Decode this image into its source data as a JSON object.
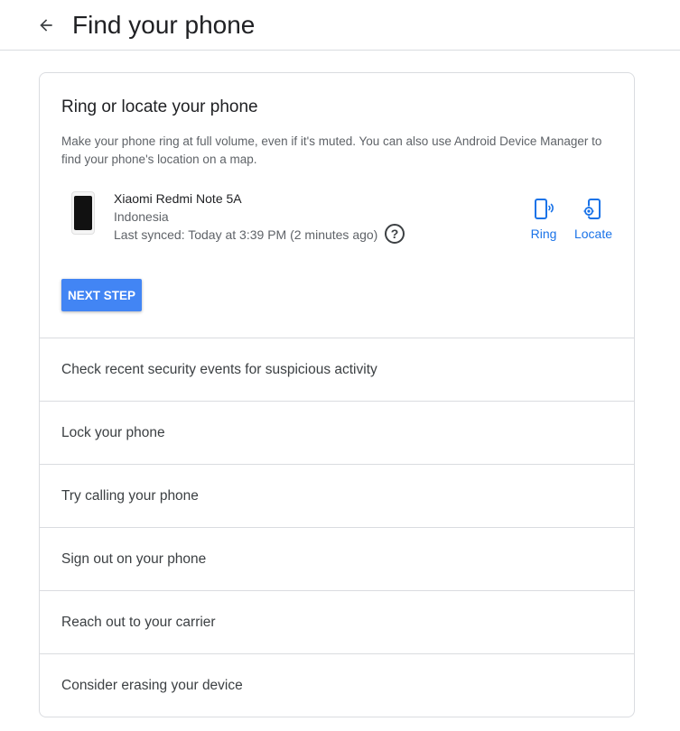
{
  "header": {
    "title": "Find your phone"
  },
  "ring_locate": {
    "title": "Ring or locate your phone",
    "description": "Make your phone ring at full volume, even if it's muted. You can also use Android Device Manager to find your phone's location on a map.",
    "device": {
      "name": "Xiaomi Redmi Note 5A",
      "country": "Indonesia",
      "last_synced": "Last synced: Today at 3:39 PM (2 minutes ago)"
    },
    "help_glyph": "?",
    "ring_label": "Ring",
    "locate_label": "Locate",
    "next_label": "NEXT STEP"
  },
  "steps": [
    {
      "label": "Check recent security events for suspicious activity"
    },
    {
      "label": "Lock your phone"
    },
    {
      "label": "Try calling your phone"
    },
    {
      "label": "Sign out on your phone"
    },
    {
      "label": "Reach out to your carrier"
    },
    {
      "label": "Consider erasing your device"
    }
  ],
  "colors": {
    "accent": "#1a73e8",
    "button": "#4285f4",
    "divider": "#dadce0"
  },
  "icons": {
    "back": "arrow-left-icon",
    "help": "help-circle-icon",
    "ring": "phone-ring-icon",
    "locate": "phone-locate-icon"
  }
}
